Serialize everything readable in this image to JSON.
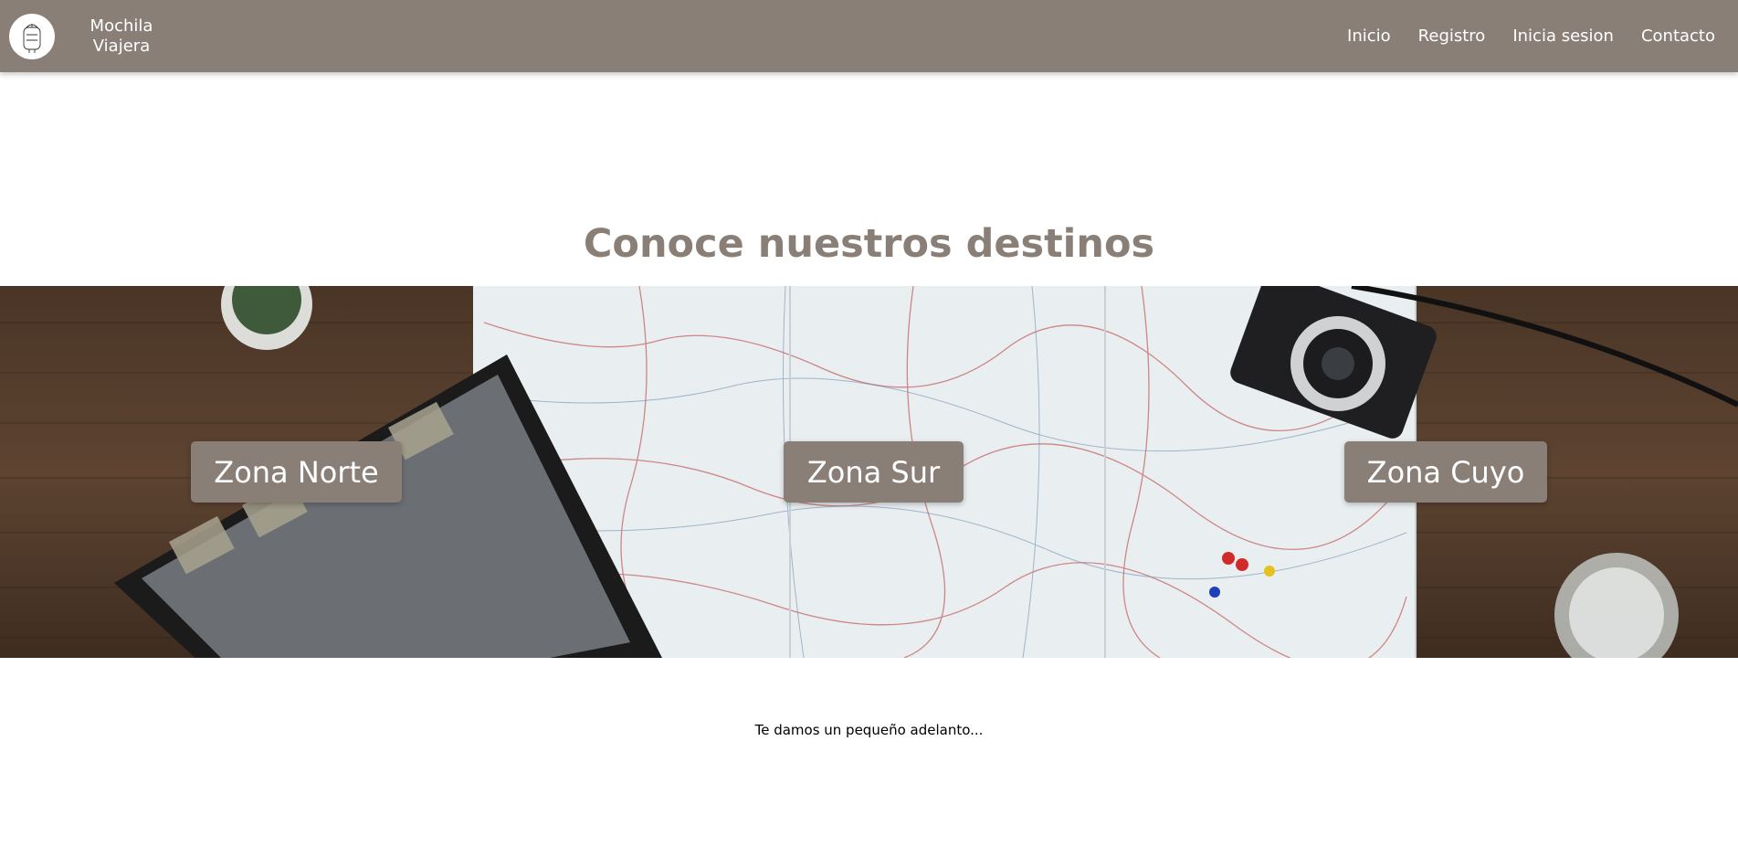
{
  "brand": {
    "name": "Mochila Viajera",
    "logo_icon": "backpack-sketch-icon"
  },
  "nav": {
    "items": [
      {
        "label": "Inicio"
      },
      {
        "label": "Registro"
      },
      {
        "label": "Inicia sesion"
      },
      {
        "label": "Contacto"
      }
    ]
  },
  "destinations": {
    "title": "Conoce nuestros destinos",
    "zones": [
      {
        "label": "Zona Norte"
      },
      {
        "label": "Zona Sur"
      },
      {
        "label": "Zona Cuyo"
      }
    ],
    "teaser": "Te damos un pequeño adelanto..."
  },
  "colors": {
    "navbar": "#8a7f77",
    "accent": "#8a7f77",
    "text_light": "#ffffff"
  }
}
